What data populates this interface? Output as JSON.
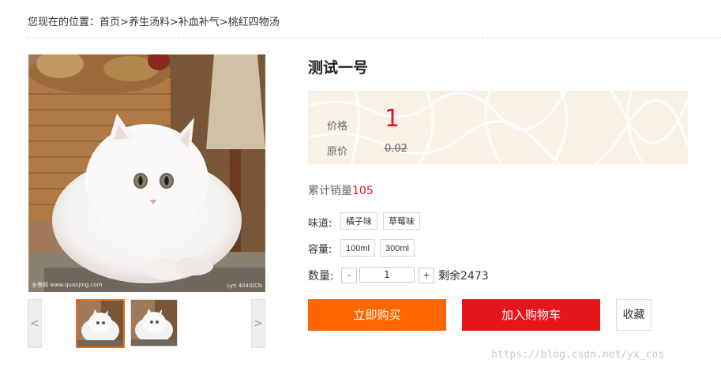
{
  "breadcrumb": {
    "prefix": "您现在的位置：",
    "items": [
      "首页",
      "养生汤料",
      "补血补气",
      "桃红四物汤"
    ],
    "separator": ">"
  },
  "product": {
    "title": "测试一号",
    "image": {
      "subject": "white-cat-photo",
      "watermark_left": "全景网 www.quanjing.com",
      "watermark_right": "Lyn 4040/CN"
    },
    "price_label": "价格",
    "price": "1",
    "original_price_label": "原价",
    "original_price": "0.02",
    "sales_label": "累计销量",
    "sales_count": "105"
  },
  "thumbnails": {
    "prev_label": "<",
    "next_label": ">",
    "count": 2,
    "active_index": 0
  },
  "options": {
    "flavor": {
      "label": "味道:",
      "values": [
        "橘子味",
        "草莓味"
      ]
    },
    "capacity": {
      "label": "容量:",
      "values": [
        "100ml",
        "300ml"
      ]
    }
  },
  "quantity": {
    "label": "数量:",
    "minus": "-",
    "value": "1",
    "plus": "+",
    "stock_text": "剩余2473"
  },
  "actions": {
    "buy_now": "立即购买",
    "add_to_cart": "加入购物车",
    "favorite": "收藏"
  },
  "colors": {
    "buy": "#ff6600",
    "cart": "#e4161c",
    "price": "#e4161c",
    "active_thumb_border": "#e96d1c"
  },
  "footer_watermark": "https://blog.csdn.net/yx_cos"
}
